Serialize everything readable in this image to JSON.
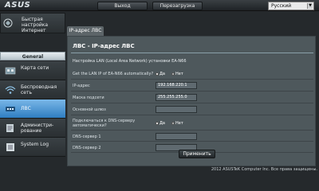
{
  "header": {
    "logo": "ASUS",
    "logout_label": "Выход",
    "reboot_label": "Перезагрузка",
    "language": "Русский"
  },
  "sidebar": {
    "quick_setup": "Быстрая настройка Интернет",
    "section_label": "General",
    "items": [
      {
        "label": "Карта сети"
      },
      {
        "label": "Беспроводная сеть"
      },
      {
        "label": "ЛВС"
      },
      {
        "label": "Администри-рование"
      },
      {
        "label": "System Log"
      }
    ]
  },
  "main": {
    "tab": "IP-адрес ЛВС",
    "title": "ЛВС - IP-адрес ЛВС",
    "description": "Настройка LAN (Local Area Network) установки EA-N66",
    "fields": {
      "auto_ip": {
        "label": "Get the LAN IP of EA-N66 automatically?",
        "yes": "Да",
        "no": "Нет",
        "selected": "no"
      },
      "ip": {
        "label": "IP-адрес",
        "value": "192.168.220.1"
      },
      "mask": {
        "label": "Маска подсети",
        "value": "255.255.255.0"
      },
      "gateway": {
        "label": "Основной шлюз",
        "value": ""
      },
      "auto_dns": {
        "label": "Подключаться к DNS-серверу автоматически?",
        "yes": "Да",
        "no": "Нет",
        "selected": "no"
      },
      "dns1": {
        "label": "DNS-сервер 1",
        "value": ""
      },
      "dns2": {
        "label": "DNS-сервер 2",
        "value": ""
      }
    },
    "apply_label": "Применить"
  },
  "footer": "2012 ASUSTeK Computer Inc. Все права защищены."
}
